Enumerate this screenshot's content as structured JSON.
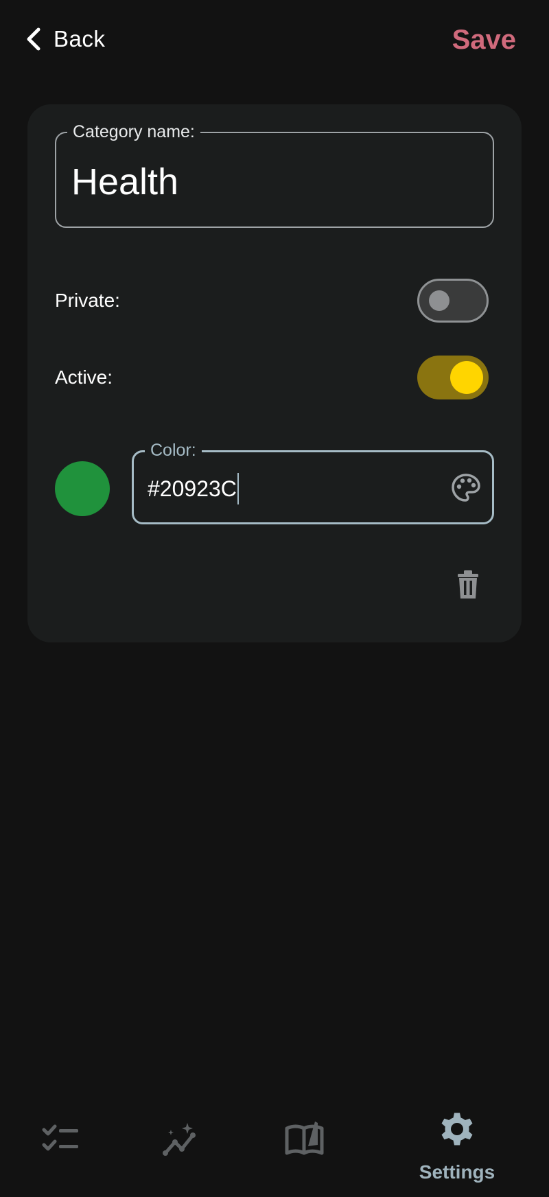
{
  "topbar": {
    "back_label": "Back",
    "save_label": "Save"
  },
  "form": {
    "name_label": "Category name:",
    "name_value": "Health",
    "private_label": "Private:",
    "private_on": false,
    "active_label": "Active:",
    "active_on": true,
    "color_label": "Color:",
    "color_value": "#20923C"
  },
  "icons": {
    "back": "chevron-left-icon",
    "palette": "palette-icon",
    "delete": "trash-icon"
  },
  "nav": {
    "items": [
      {
        "icon": "checklist-icon",
        "label": ""
      },
      {
        "icon": "analytics-icon",
        "label": ""
      },
      {
        "icon": "book-icon",
        "label": ""
      },
      {
        "icon": "settings-gear-icon",
        "label": "Settings",
        "active": true
      }
    ]
  },
  "colors": {
    "accent_save": "#d06a7c",
    "toggle_on": "#ffd500",
    "swatch": "#20923C",
    "nav_active": "#9fb3bd"
  }
}
